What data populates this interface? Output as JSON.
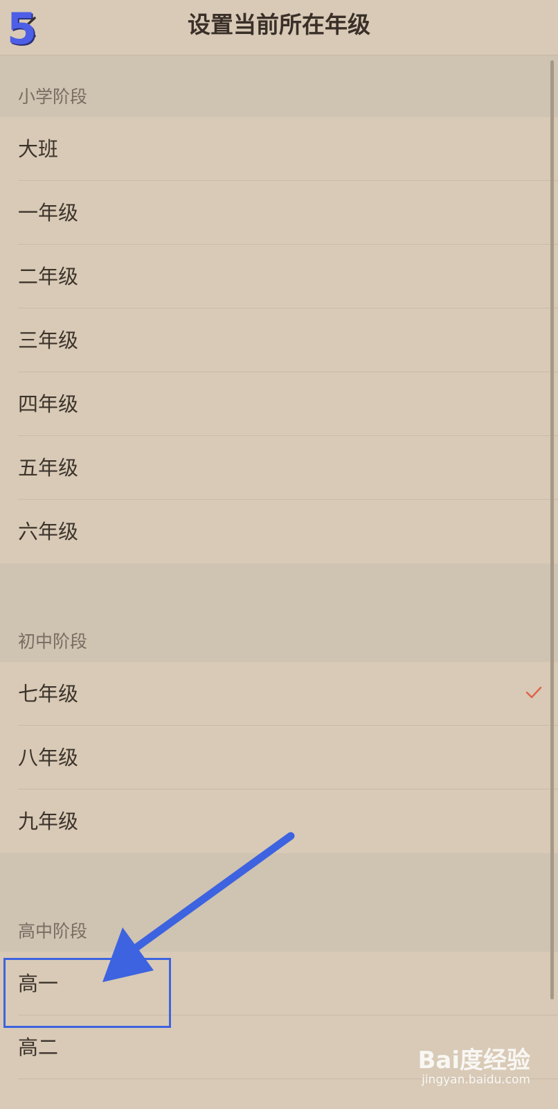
{
  "step_badge": "5",
  "header": {
    "title": "设置当前所在年级"
  },
  "sections": [
    {
      "title": "小学阶段",
      "items": [
        "大班",
        "一年级",
        "二年级",
        "三年级",
        "四年级",
        "五年级",
        "六年级"
      ]
    },
    {
      "title": "初中阶段",
      "items": [
        "七年级",
        "八年级",
        "九年级"
      ]
    },
    {
      "title": "高中阶段",
      "items": [
        "高一",
        "高二"
      ]
    }
  ],
  "selected_item": "七年级",
  "colors": {
    "background": "#d8cab6",
    "section_bg": "#cfc3b1",
    "check": "#e0614a",
    "annotation": "#3d63e0",
    "step_badge": "#4d5fe6"
  },
  "watermark": {
    "brand": "Bai度经验",
    "url": "jingyan.baidu.com"
  }
}
